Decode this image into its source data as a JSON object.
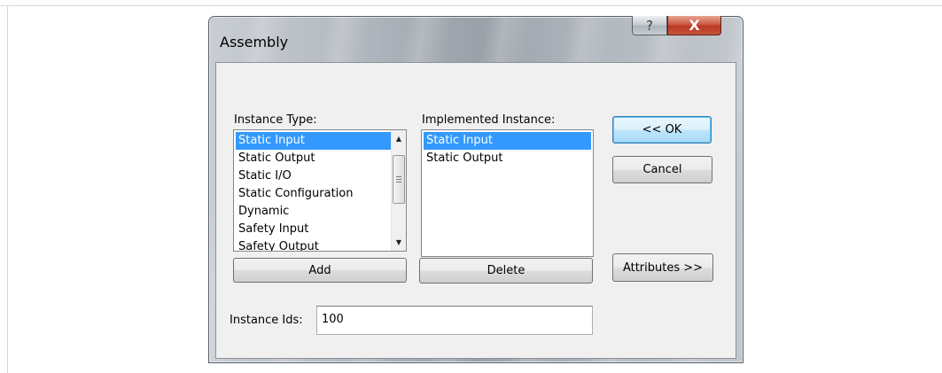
{
  "window": {
    "title": "Assembly",
    "help_label": "?",
    "close_label": "X"
  },
  "instance_type": {
    "label": "Instance Type:",
    "items": [
      "Static Input",
      "Static Output",
      "Static I/O",
      "Static Configuration",
      "Dynamic",
      "Safety Input",
      "Safety Output"
    ],
    "selected": "Static Input"
  },
  "implemented_instance": {
    "label": "Implemented Instance:",
    "items": [
      "Static Input",
      "Static Output"
    ],
    "selected": "Static Input"
  },
  "buttons": {
    "ok": "<< OK",
    "cancel": "Cancel",
    "add": "Add",
    "delete": "Delete",
    "attributes": "Attributes >>"
  },
  "instance_ids": {
    "label": "Instance Ids:",
    "value": "100"
  },
  "icons": {
    "scroll_up": "up-arrow",
    "scroll_down": "down-arrow",
    "scroll_grip": "grip-lines"
  },
  "colors": {
    "selection": "#3399ff",
    "close_button": "#c8543b",
    "default_button_border": "#3c7fb1"
  }
}
